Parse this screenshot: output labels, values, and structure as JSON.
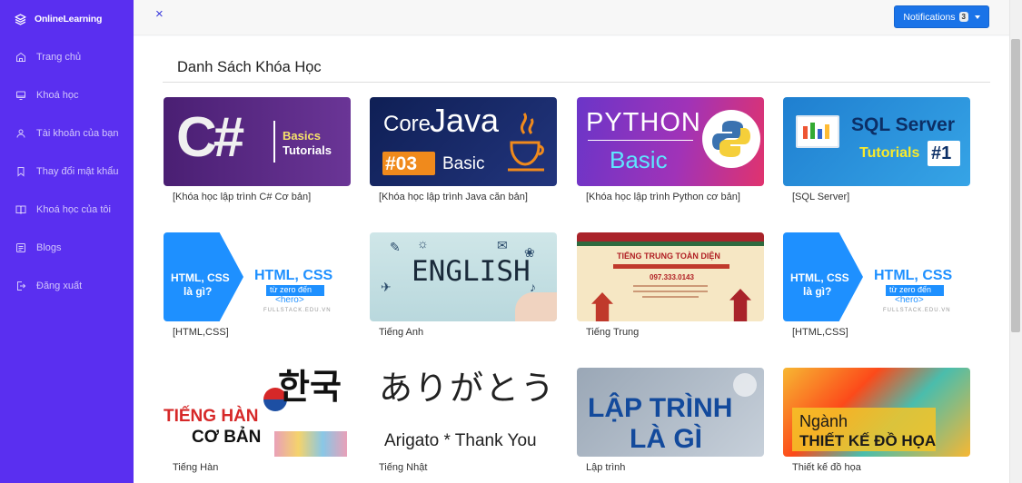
{
  "brand": {
    "name": "OnlineLearning"
  },
  "sidebar": {
    "items": [
      {
        "label": "Trang chủ",
        "icon": "home-icon"
      },
      {
        "label": "Khoá học",
        "icon": "monitor-icon"
      },
      {
        "label": "Tài khoản của bạn",
        "icon": "user-icon"
      },
      {
        "label": "Thay đổi mật khẩu",
        "icon": "bookmark-icon"
      },
      {
        "label": "Khoá học của tôi",
        "icon": "book-icon"
      },
      {
        "label": "Blogs",
        "icon": "blog-icon"
      },
      {
        "label": "Đăng xuất",
        "icon": "logout-icon"
      }
    ]
  },
  "topbar": {
    "close_symbol": "×",
    "notifications_label": "Notifications",
    "notifications_count": "3"
  },
  "main": {
    "title": "Danh Sách Khóa Học",
    "courses": [
      {
        "caption": "[Khóa học lập trình C# Cơ bản]",
        "thumb": {
          "line1": "C#",
          "line2": "Basics",
          "line3": "Tutorials"
        }
      },
      {
        "caption": "[Khóa học lập trình Java căn bản]",
        "thumb": {
          "line1": "Core",
          "line2": "Java",
          "line3": "#03",
          "line4": "Basic"
        }
      },
      {
        "caption": "[Khóa học lập trình Python cơ bản]",
        "thumb": {
          "line1": "PYTHON",
          "line2": "Basic"
        }
      },
      {
        "caption": "[SQL Server]",
        "thumb": {
          "line1": "SQL Server",
          "line2": "Tutorials",
          "line3": "#1"
        }
      },
      {
        "caption": "[HTML,CSS]",
        "thumb": {
          "line1": "HTML, CSS",
          "line2": "là gì?",
          "line3": "HTML, CSS",
          "line4": "từ zero đến",
          "line5": "<hero>",
          "line6": "FULLSTACK.EDU.VN"
        }
      },
      {
        "caption": "Tiếng Anh",
        "thumb": {
          "line1": "ENGLISH"
        }
      },
      {
        "caption": "Tiếng Trung",
        "thumb": {
          "line1": "TIẾNG TRUNG TOÀN DIỆN",
          "line2": "097.333.0143"
        }
      },
      {
        "caption": "[HTML,CSS]",
        "thumb": {
          "line1": "HTML, CSS",
          "line2": "là gì?",
          "line3": "HTML, CSS",
          "line4": "từ zero đến",
          "line5": "<hero>",
          "line6": "FULLSTACK.EDU.VN"
        }
      },
      {
        "caption": "Tiếng Hàn",
        "thumb": {
          "line1": "TIẾNG HÀN",
          "line2": "CƠ BẢN",
          "line3": "한국"
        }
      },
      {
        "caption": "Tiếng Nhật",
        "thumb": {
          "line1": "ありがとう",
          "line2": "Arigato * Thank You"
        }
      },
      {
        "caption": "Lập trình",
        "thumb": {
          "line1": "LẬP TRÌNH",
          "line2": "LÀ GÌ"
        }
      },
      {
        "caption": "Thiết kế đồ họa",
        "thumb": {
          "line1": "Ngành",
          "line2": "THIẾT KẾ ĐỒ HỌA"
        }
      }
    ]
  },
  "colors": {
    "sidebar": "#5a2ff0",
    "primary_button": "#1a73e8",
    "csharp_bg": "#5b2a86",
    "java_bg": "#1b2a6b",
    "python_bg": "#7a3fc0",
    "sql_bg": "#2a8fd6",
    "html_bg": "#1e90ff"
  }
}
